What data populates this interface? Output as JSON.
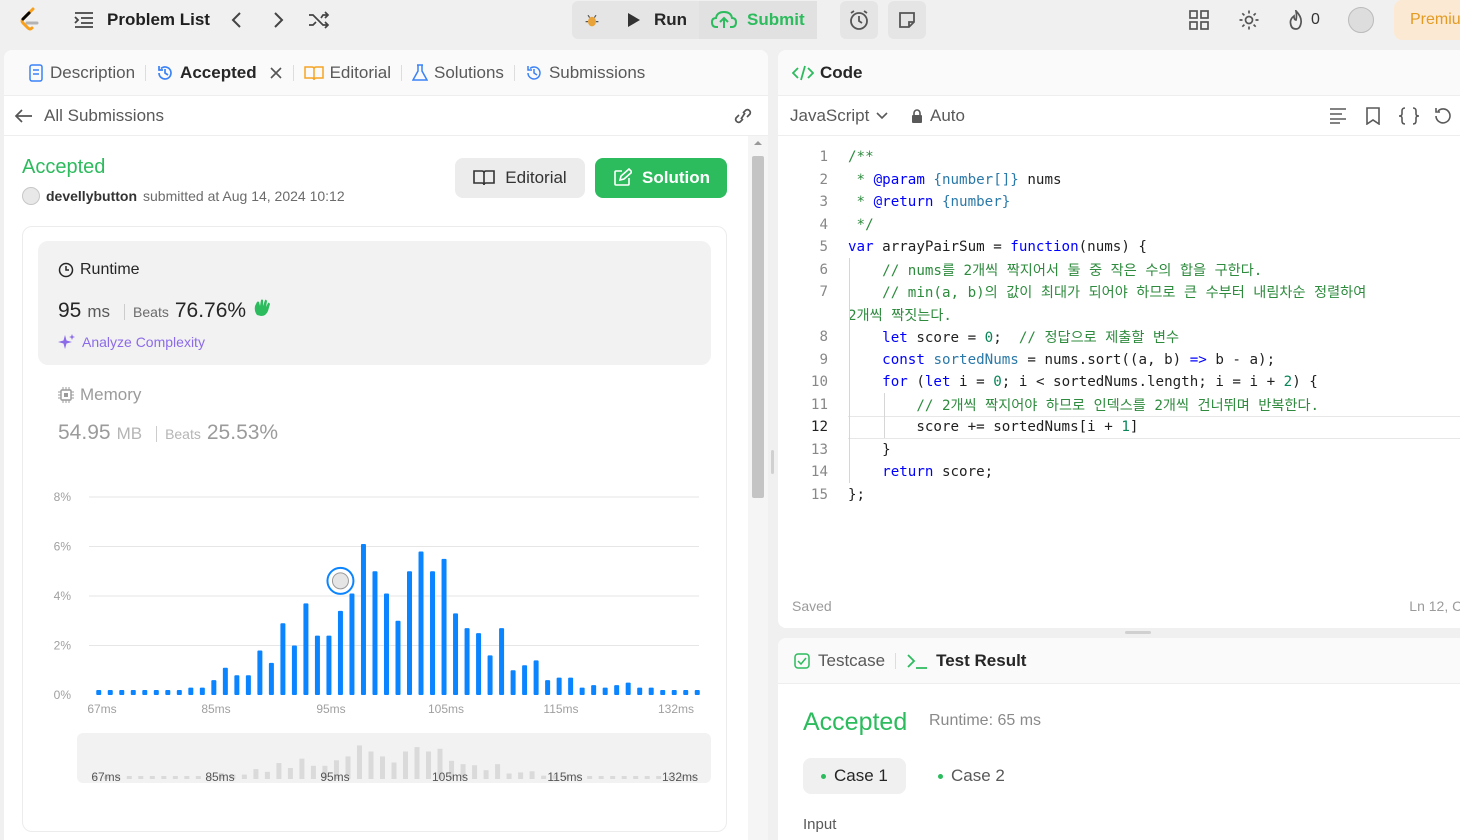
{
  "topbar": {
    "title": "Problem List",
    "run_label": "Run",
    "submit_label": "Submit",
    "streak": "0",
    "premium_label": "Premiu"
  },
  "left_tabs": [
    {
      "label": "Description"
    },
    {
      "label": "Accepted"
    },
    {
      "label": "Editorial"
    },
    {
      "label": "Solutions"
    },
    {
      "label": "Submissions"
    }
  ],
  "subnav": {
    "back_label": "All Submissions"
  },
  "submission": {
    "status": "Accepted",
    "user": "develly​button",
    "submitted_text": "submitted at Aug 14, 2024 10:12",
    "editorial_btn": "Editorial",
    "solution_btn": "Solution"
  },
  "runtime": {
    "label": "Runtime",
    "value": "95",
    "unit": "ms",
    "beats_label": "Beats",
    "beats_value": "76.76%",
    "analyze": "Analyze Complexity"
  },
  "memory": {
    "label": "Memory",
    "value": "54.95",
    "unit": "MB",
    "beats_label": "Beats",
    "beats_value": "25.53%"
  },
  "chart_data": {
    "type": "bar",
    "ylabel_ticks": [
      "0%",
      "2%",
      "4%",
      "6%",
      "8%"
    ],
    "ylim": [
      0,
      8
    ],
    "x_tick_labels": [
      "67ms",
      "85ms",
      "95ms",
      "105ms",
      "115ms",
      "132ms"
    ],
    "values": [
      0.2,
      0.2,
      0.2,
      0.2,
      0.2,
      0.2,
      0.2,
      0.2,
      0.3,
      0.3,
      0.6,
      1.1,
      0.8,
      0.8,
      1.8,
      1.3,
      2.9,
      2.0,
      3.7,
      2.4,
      2.4,
      3.4,
      4.1,
      6.1,
      5.0,
      4.1,
      3.0,
      5.0,
      5.8,
      5.0,
      5.5,
      3.3,
      2.7,
      2.5,
      1.6,
      2.7,
      1.0,
      1.2,
      1.4,
      0.6,
      0.7,
      0.7,
      0.3,
      0.4,
      0.3,
      0.4,
      0.5,
      0.3,
      0.3,
      0.2,
      0.2,
      0.2,
      0.2
    ],
    "highlight_index": 21,
    "mini_ticks": [
      "67ms",
      "85ms",
      "95ms",
      "105ms",
      "115ms",
      "132ms"
    ],
    "color": "#0a84ff"
  },
  "code_panel": {
    "title": "Code",
    "language": "JavaScript",
    "mode": "Auto",
    "saved": "Saved",
    "cursor": "Ln 12, Co",
    "current_line": 12
  },
  "test_panel": {
    "tab_testcase": "Testcase",
    "tab_result": "Test Result",
    "status": "Accepted",
    "runtime": "Runtime: 65 ms",
    "case1": "Case 1",
    "case2": "Case 2",
    "input_label": "Input"
  },
  "colors": {
    "accent": "#2cbb5d",
    "bar": "#0a84ff",
    "purple": "#8c6be8"
  }
}
